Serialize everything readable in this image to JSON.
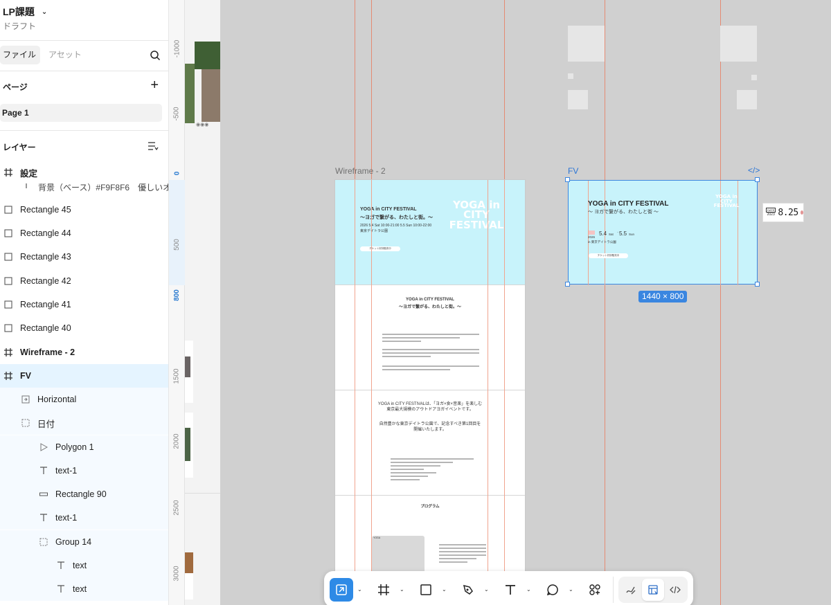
{
  "file": {
    "title": "LP課題",
    "subtitle": "ドラフト"
  },
  "tabs": {
    "file": "ファイル",
    "assets": "アセット"
  },
  "pages": {
    "heading": "ページ",
    "items": [
      "Page 1"
    ]
  },
  "layers": {
    "heading": "レイヤー",
    "items": [
      {
        "label": "設定",
        "icon": "frame-icon",
        "bold": true
      },
      {
        "label": "背景（ベース）#F9F8F6　優しいオ",
        "icon": "text-icon",
        "bold": false
      },
      {
        "label": "Rectangle 45",
        "icon": "rectangle-icon",
        "bold": false
      },
      {
        "label": "Rectangle 44",
        "icon": "rectangle-icon",
        "bold": false
      },
      {
        "label": "Rectangle 43",
        "icon": "rectangle-icon",
        "bold": false
      },
      {
        "label": "Rectangle 42",
        "icon": "rectangle-icon",
        "bold": false
      },
      {
        "label": "Rectangle 41",
        "icon": "rectangle-icon",
        "bold": false
      },
      {
        "label": "Rectangle 40",
        "icon": "rectangle-icon",
        "bold": false
      },
      {
        "label": "Wireframe - 2",
        "icon": "frame-icon",
        "bold": true
      },
      {
        "label": "FV",
        "icon": "frame-icon",
        "bold": true,
        "selected": true
      },
      {
        "label": "Horizontal",
        "icon": "horizontal-layout-icon",
        "bold": false
      },
      {
        "label": "日付",
        "icon": "group-icon",
        "bold": false
      },
      {
        "label": "Polygon 1",
        "icon": "polygon-icon",
        "bold": false
      },
      {
        "label": "text-1",
        "icon": "text-icon",
        "bold": false
      },
      {
        "label": "Rectangle 90",
        "icon": "rectangle-line-icon",
        "bold": false
      },
      {
        "label": "text-1",
        "icon": "text-icon",
        "bold": false
      },
      {
        "label": "Group 14",
        "icon": "group-icon",
        "bold": false
      },
      {
        "label": "text",
        "icon": "text-icon",
        "bold": false
      },
      {
        "label": "text",
        "icon": "text-icon",
        "bold": false
      }
    ]
  },
  "ruler": {
    "marks": [
      "-1000",
      "-500",
      "0",
      "500",
      "800",
      "1500",
      "2000",
      "2500",
      "3000"
    ],
    "highlight": [
      "0",
      "800"
    ]
  },
  "canvas": {
    "wireframe_label": "Wireframe - 2",
    "fv_label": "FV",
    "size_badge": "1440 × 800",
    "code_tag": "</>",
    "colors": {
      "hero_bg": "#c8f3fb",
      "guide": "#e48a72",
      "selection": "#3a86e0"
    }
  },
  "wireframe": {
    "hero_title": "YOGA in CITY FESTIVAL",
    "hero_subtitle": "〜ヨガで繋がる、わたしと街。〜",
    "hero_date": "2026 5.4 Sat 10:00-21:00  5.5 Sun 10:00-22:00",
    "hero_place": "東京デイトラ公園",
    "hero_cta": "チケット好評販売中",
    "hero_logo": "YOGA in CITY FESTIVAL",
    "sec2_title": "YOGA in CITY FESTIVAL",
    "sec2_subtitle": "〜ヨガで繋がる、わたしと街。〜",
    "sec3_line1": "YOGA in CITY FESTIVALは、「ヨガ×食×音楽」を楽しむ",
    "sec3_line2": "東京最大規模のアウトドアヨガイベントです。",
    "sec3_line3": "自然豊かな東京デイトラ公園で、記念すべき第1回目を",
    "sec3_line4": "開催いたします。",
    "sec4_title": "プログラム",
    "sec4_card": "YOGA"
  },
  "fv": {
    "title": "YOGA in CITY FESTIVAL",
    "subtitle": "〜 ヨガで繋がる、わたしと街 〜",
    "year": "2026",
    "date1": "5.4",
    "day1": "Sat",
    "date2": "5.5",
    "day2": "Sun",
    "place": "in 東京デイトラ公園",
    "cta": "チケット好評販売中",
    "logo": "YOGA in CITY FESTIVAL"
  },
  "date_card": {
    "tag": "DATE",
    "year": "2023",
    "date": "8.25"
  },
  "toolbar": {
    "tools": [
      "move-tool",
      "frame-tool",
      "rectangle-tool",
      "pen-tool",
      "text-tool",
      "comment-tool",
      "actions-tool"
    ],
    "modes": [
      "draw-mode",
      "design-mode",
      "dev-mode"
    ]
  }
}
